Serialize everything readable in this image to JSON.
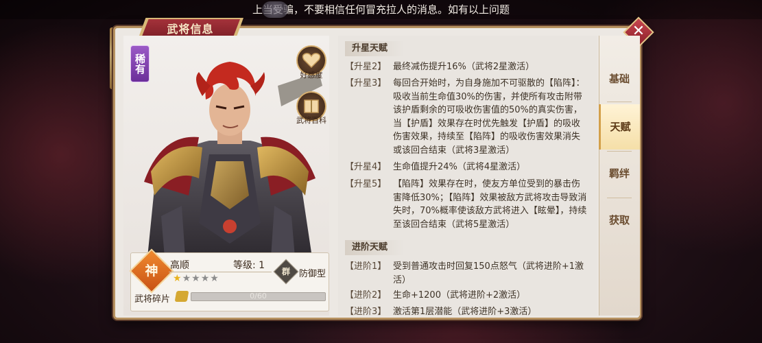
{
  "marquee": {
    "text": "上当受骗，不要相信任何冒充拉人的消息。如有以上问题"
  },
  "panel": {
    "title": "武将信息",
    "close_glyph": "✕"
  },
  "hero": {
    "rarity": "稀有",
    "name": "高顺",
    "level_label": "等级: 1",
    "star_rating": 1,
    "stars_total": 5,
    "grade_badge": "神",
    "faction_badge": "群",
    "role": "防御型",
    "shards_label": "武将碎片",
    "shards_progress": "0/60",
    "affection_label": "好感度",
    "encyclopedia_label": "武将百科"
  },
  "tabs": [
    {
      "label": "基础",
      "active": false
    },
    {
      "label": "天赋",
      "active": true
    },
    {
      "label": "羁绊",
      "active": false
    },
    {
      "label": "获取",
      "active": false
    }
  ],
  "talents": {
    "star_header": "升星天赋",
    "star_entries": [
      {
        "tag": "【升星2】",
        "text": "最终减伤提升16%（武将2星激活）"
      },
      {
        "tag": "【升星3】",
        "text": "每回合开始时，为自身施加不可驱散的【陷阵】：吸收当前生命值30%的伤害，并使所有攻击附带该护盾剩余的可吸收伤害值的50%的真实伤害，当【护盾】效果存在时优先触发【护盾】的吸收伤害效果，持续至【陷阵】的吸收伤害效果消失或该回合结束（武将3星激活）"
      },
      {
        "tag": "【升星4】",
        "text": "生命值提升24%（武将4星激活）"
      },
      {
        "tag": "【升星5】",
        "text": "【陷阵】效果存在时，使友方单位受到的暴击伤害降低30%；【陷阵】效果被敌方武将攻击导致消失时，70%概率使该敌方武将进入【眩晕】，持续至该回合结束（武将5星激活）"
      }
    ],
    "advance_header": "进阶天赋",
    "advance_entries": [
      {
        "tag": "【进阶1】",
        "text": "受到普通攻击时回复150点怒气（武将进阶+1激活）"
      },
      {
        "tag": "【进阶2】",
        "text": "生命+1200（武将进阶+2激活）"
      },
      {
        "tag": "【进阶3】",
        "text": "激活第1层潜能（武将进阶+3激活）"
      }
    ]
  }
}
